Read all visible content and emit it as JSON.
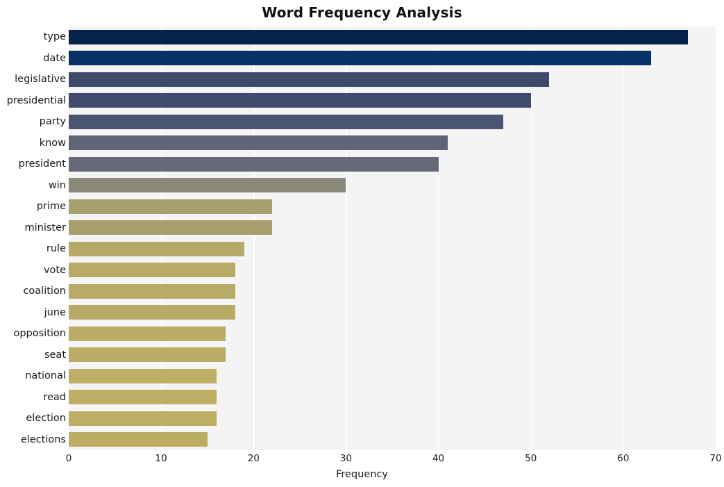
{
  "chart_data": {
    "type": "bar",
    "orientation": "horizontal",
    "title": "Word Frequency Analysis",
    "xlabel": "Frequency",
    "ylabel": "",
    "categories": [
      "type",
      "date",
      "legislative",
      "presidential",
      "party",
      "know",
      "president",
      "win",
      "prime",
      "minister",
      "rule",
      "vote",
      "coalition",
      "june",
      "opposition",
      "seat",
      "national",
      "read",
      "election",
      "elections"
    ],
    "values": [
      67,
      63,
      52,
      50,
      47,
      41,
      40,
      30,
      22,
      22,
      19,
      18,
      18,
      18,
      17,
      17,
      16,
      16,
      16,
      15
    ],
    "bar_colors": [
      "#05224a",
      "#083268",
      "#3f4a६b",
      "#414b6d",
      "#4b5470",
      "#5f6477",
      "#666a78",
      "#8a8878",
      "#a79f6e",
      "#a89f6d",
      "#b6a968",
      "#b8ab67",
      "#b8ab67",
      "#b8ab67",
      "#bbad65",
      "#bbad65",
      "#bcae64",
      "#bcae64",
      "#bcae64",
      "#bdad63"
    ],
    "xlim": [
      0,
      70
    ],
    "xticks": [
      0,
      10,
      20,
      30,
      40,
      50,
      60,
      70
    ],
    "xtick_labels": [
      "0",
      "10",
      "20",
      "30",
      "40",
      "50",
      "60",
      "70"
    ],
    "grid": true,
    "grid_color": "#ffffff",
    "plot_background": "#f4f4f5",
    "figure_background": "#ffffff",
    "legend": null,
    "colormap": "cividis_r"
  }
}
